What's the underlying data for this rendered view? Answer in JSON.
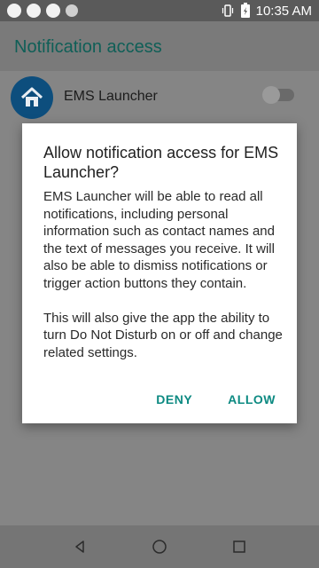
{
  "status_bar": {
    "time": "10:35 AM"
  },
  "app_bar": {
    "title": "Notification access"
  },
  "list": {
    "item_label": "EMS Launcher"
  },
  "dialog": {
    "title": "Allow notification access for EMS Launcher?",
    "body_paragraphs": [
      "EMS Launcher will be able to read all notifications, including personal information such as contact names and the text of messages you receive. It will also be able to dismiss notifications or trigger action buttons they contain.",
      "This will also give the app the ability to turn Do Not Disturb on or off and change related settings."
    ],
    "deny_label": "DENY",
    "allow_label": "ALLOW"
  },
  "icons": {
    "status_left": [
      "circle-icon",
      "circle-icon",
      "chat-bubble-icon",
      "sync-dot-icon"
    ],
    "status_right": [
      "vibrate-icon",
      "battery-charging-icon"
    ],
    "nav": [
      "back-icon",
      "home-icon",
      "recents-icon"
    ]
  }
}
